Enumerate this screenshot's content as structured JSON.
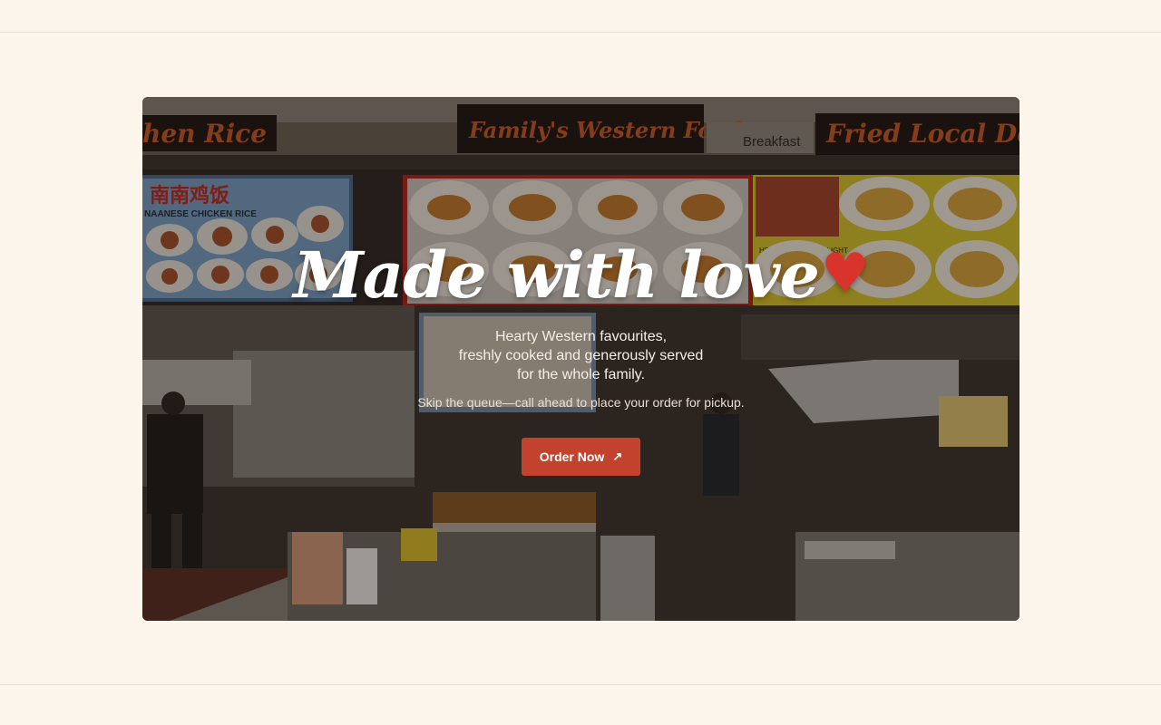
{
  "hero": {
    "headline": "Made with love",
    "heart_icon": "heart-icon",
    "tagline_lines": [
      "Hearty Western favourites,",
      "freshly cooked and generously served",
      "for the whole family."
    ],
    "note": "Skip the queue—call ahead to place your order for pickup.",
    "cta_label": "Order Now",
    "cta_icon": "arrow-up-right-icon",
    "signs": {
      "left": "hen Rice",
      "center": "Family's Western Food",
      "right": "Fried Local Delig",
      "breakfast": "Breakfast",
      "chinese_left": "南南鸡饭",
      "chinese_left_sub": "NAANESE CHICKEN RICE",
      "right_sub": "HEI JIAN LOCAL DELIGHT"
    }
  },
  "colors": {
    "page_bg": "#fcf5ec",
    "accent": "#c2422d",
    "heart": "#d9342b"
  }
}
